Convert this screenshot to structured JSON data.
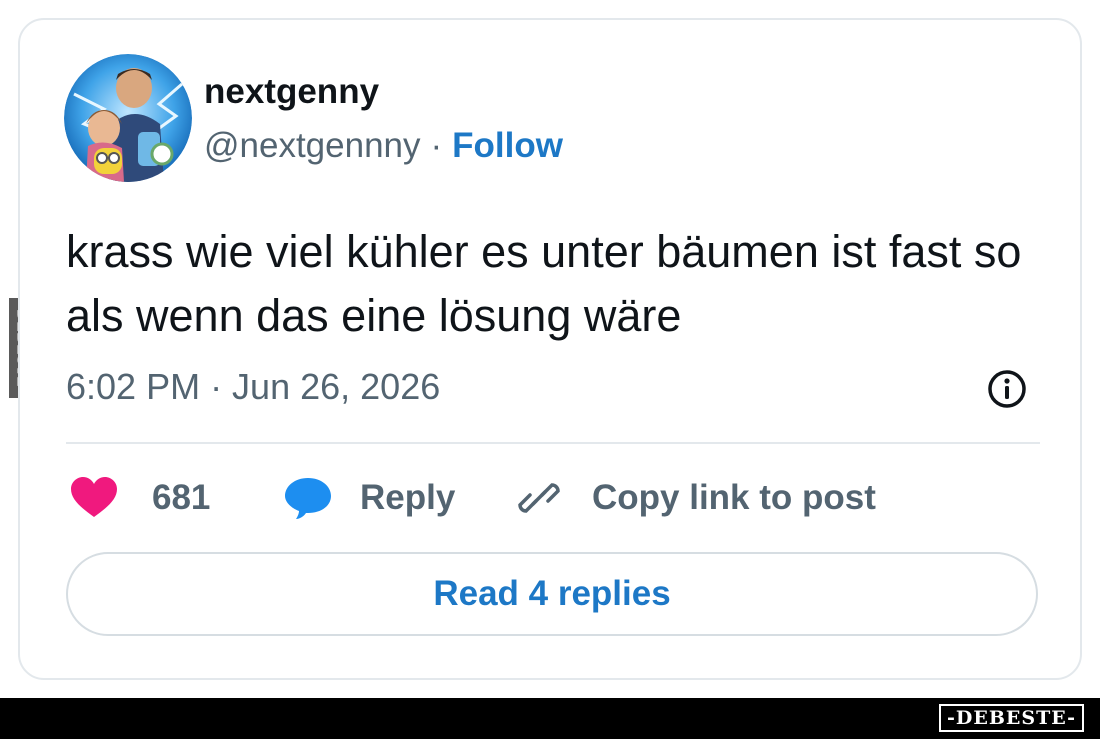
{
  "watermark": {
    "side_text": "DEBESTE",
    "logo_text": "-DEBESTE-"
  },
  "tweet": {
    "display_name": "nextgenny",
    "handle": "@nextgennny",
    "separator": "·",
    "follow_label": "Follow",
    "text": "krass wie viel kühler es unter bäumen ist fast so als wenn das eine lösung wäre",
    "timestamp": "6:02 PM · Jun 26, 2026"
  },
  "actions": {
    "like_count": "681",
    "reply_label": "Reply",
    "copy_link_label": "Copy link to post",
    "read_replies_label": "Read 4 replies"
  },
  "icons": {
    "avatar": "avatar-photo",
    "info": "info-icon",
    "like": "heart-icon",
    "reply": "speech-bubble-icon",
    "copy_link": "link-icon"
  },
  "colors": {
    "heart": "#f0197e",
    "reply": "#1d8ef0",
    "link_blue": "#1d78c6",
    "muted_text": "#536471",
    "card_border": "#e3e8ec"
  }
}
